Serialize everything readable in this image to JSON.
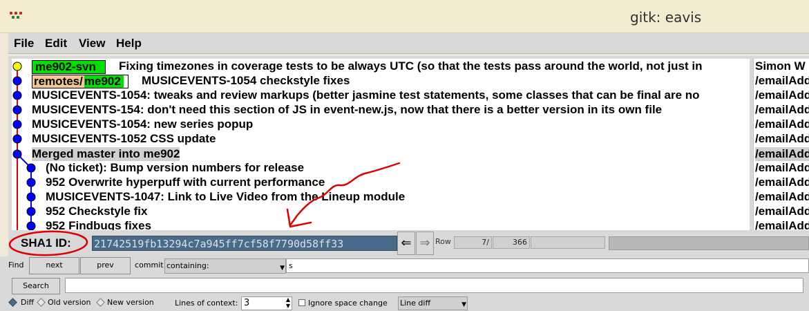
{
  "window": {
    "title": "gitk: eavis"
  },
  "menu": {
    "items": [
      "File",
      "Edit",
      "View",
      "Help"
    ]
  },
  "commits": [
    {
      "subject": "Fixing timezones in coverage tests to be always UTC (so that the tests pass around the world, not just in",
      "author": "Simon W",
      "tags": [
        {
          "kind": "local",
          "name": "me902-svn"
        }
      ]
    },
    {
      "subject": "MUSICEVENTS-1054 checkstyle fixes",
      "author": "/emailAdd",
      "tags": [
        {
          "kind": "remote",
          "prefix": "remotes/",
          "name": "me902"
        }
      ]
    },
    {
      "subject": "MUSICEVENTS-1054: tweaks and review markups (better jasmine test statements, some classes that can be final are no",
      "author": "/emailAdd"
    },
    {
      "subject": "MUSICEVENTS-154: don't need this section of JS in event-new.js, now that there is a better version in its own file",
      "author": "/emailAdd"
    },
    {
      "subject": "MUSICEVENTS-1054: new series popup",
      "author": "/emailAdd"
    },
    {
      "subject": "MUSICEVENTS-1052 CSS update",
      "author": "/emailAdd"
    },
    {
      "subject": "Merged master into me902",
      "author": "/emailAdd",
      "selected": true
    },
    {
      "subject": "(No ticket): Bump version numbers for release",
      "author": "/emailAdd"
    },
    {
      "subject": "952 Overwrite hyperpuff with current performance",
      "author": "/emailAdd"
    },
    {
      "subject": "MUSICEVENTS-1047: Link to Live Video from the Lineup module",
      "author": "/emailAdd"
    },
    {
      "subject": "952 Checkstyle fix",
      "author": "/emailAdd"
    },
    {
      "subject": "952 Findbugs fixes",
      "author": "/emailAdd"
    }
  ],
  "sha": {
    "label": "SHA1 ID:",
    "value": "21742519fb13294c7a945ff7cf58f7790d58ff33",
    "back_glyph": "⇐",
    "forward_glyph": "⇒",
    "row_label": "Row",
    "row_current": "7/",
    "row_total": "366"
  },
  "find": {
    "label": "Find",
    "next_label": "next",
    "prev_label": "prev",
    "commit_label": "commit",
    "mode": "containing:",
    "value": "s"
  },
  "search": {
    "button_label": "Search",
    "value": ""
  },
  "diff": {
    "modes": [
      "Diff",
      "Old version",
      "New version"
    ],
    "selected_mode": "Diff",
    "context_label": "Lines of context:",
    "context_value": "3",
    "ignore_space_label": "Ignore space change",
    "ignore_space_checked": false,
    "diff_style": "Line diff"
  },
  "colors": {
    "head_node": "#ffff00",
    "commit_node": "#0000ff",
    "graph_line": "#e00000",
    "branch_tag": "#00e000",
    "remote_prefix": "#f3c88e",
    "annotation": "#e00000"
  }
}
